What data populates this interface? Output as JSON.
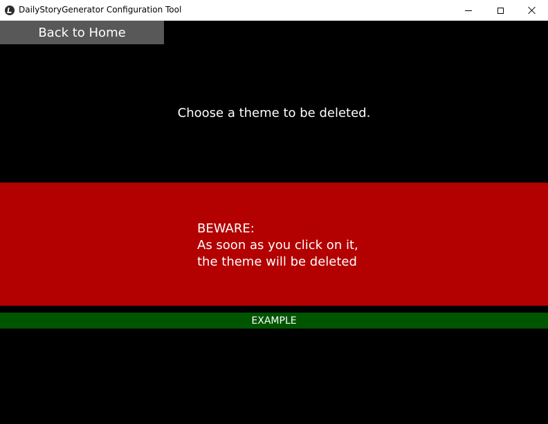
{
  "window": {
    "title": "DailyStoryGenerator Configuration Tool",
    "app_icon": "app-logo-icon",
    "controls": {
      "minimize_icon": "minimize-icon",
      "maximize_icon": "maximize-icon",
      "close_icon": "close-icon"
    }
  },
  "screen": {
    "back_button_label": "Back to Home",
    "instruction": "Choose a theme to be deleted.",
    "warning": {
      "line1": "BEWARE:",
      "line2": "As soon as you click on it,",
      "line3": "the theme will be deleted"
    },
    "themes": [
      {
        "label": "EXAMPLE"
      }
    ]
  },
  "colors": {
    "background": "#000000",
    "back_button": "#585858",
    "warning_panel": "#b30000",
    "theme_button": "#005500",
    "text": "#ffffff"
  }
}
